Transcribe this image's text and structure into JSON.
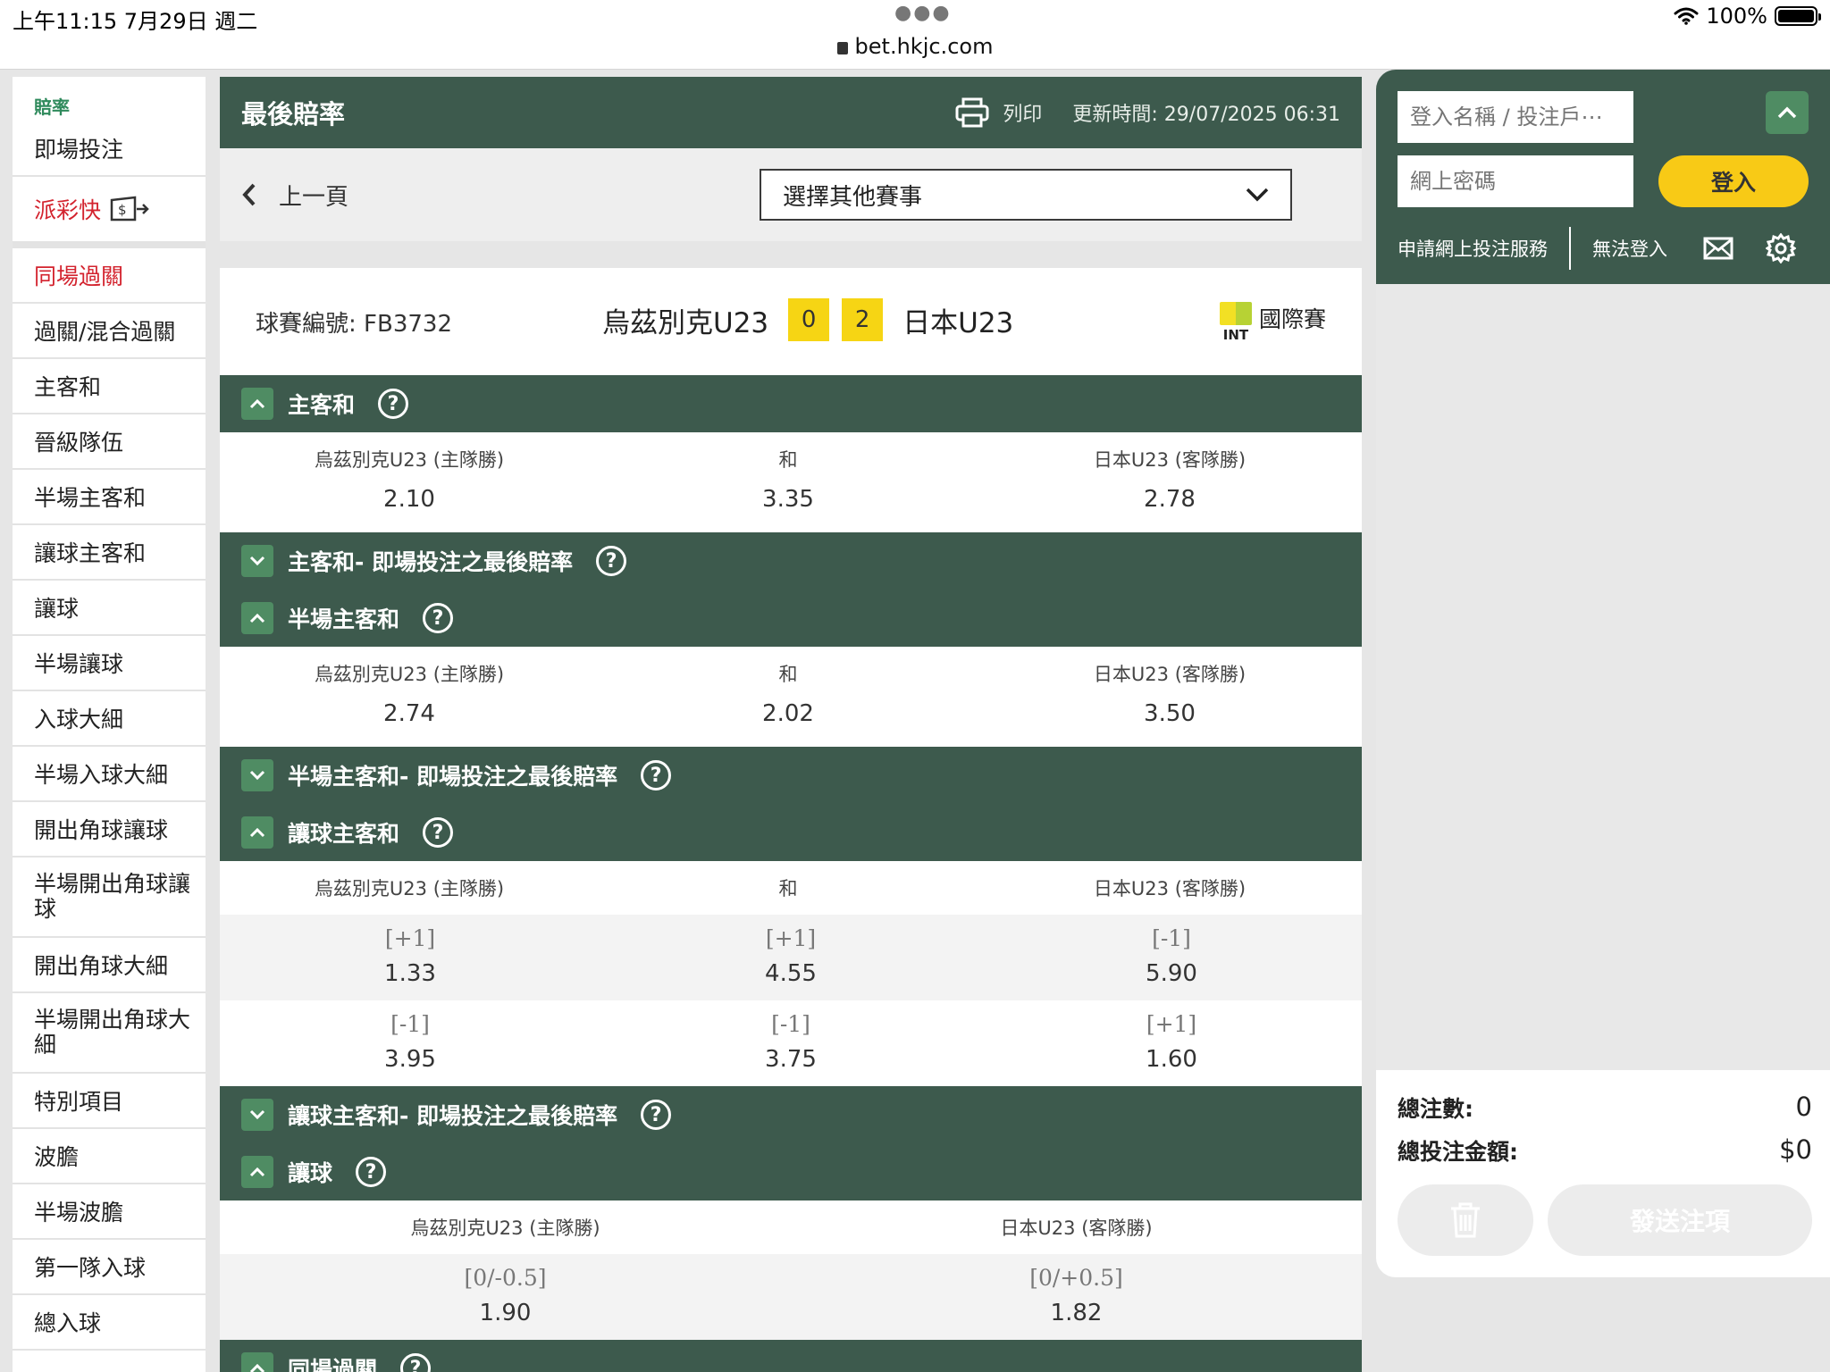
{
  "status_bar": {
    "time": "上午11:15   7月29日 週二",
    "url": "bet.hkjc.com",
    "battery": "100%",
    "battery_level": 1.0
  },
  "sidebar": {
    "header": "賠率",
    "items": [
      {
        "label": "即場投注",
        "style": "normal"
      },
      {
        "label": "派彩快",
        "style": "red-wallet"
      },
      {
        "label": "同場過關",
        "style": "red"
      },
      {
        "label": "過關/混合過關",
        "style": "normal"
      },
      {
        "label": "主客和",
        "style": "normal"
      },
      {
        "label": "晉級隊伍",
        "style": "normal"
      },
      {
        "label": "半場主客和",
        "style": "normal"
      },
      {
        "label": "讓球主客和",
        "style": "normal"
      },
      {
        "label": "讓球",
        "style": "normal"
      },
      {
        "label": "半場讓球",
        "style": "normal"
      },
      {
        "label": "入球大細",
        "style": "normal"
      },
      {
        "label": "半場入球大細",
        "style": "normal"
      },
      {
        "label": "開出角球讓球",
        "style": "normal"
      },
      {
        "label": "半場開出角球讓球",
        "style": "tall"
      },
      {
        "label": "開出角球大細",
        "style": "normal"
      },
      {
        "label": "半場開出角球大細",
        "style": "tall"
      },
      {
        "label": "特別項目",
        "style": "normal"
      },
      {
        "label": "波膽",
        "style": "normal"
      },
      {
        "label": "半場波膽",
        "style": "normal"
      },
      {
        "label": "第一隊入球",
        "style": "normal"
      },
      {
        "label": "總入球",
        "style": "normal"
      }
    ]
  },
  "header": {
    "title": "最後賠率",
    "print_label": "列印",
    "update_time": "更新時間: 29/07/2025 06:31"
  },
  "nav": {
    "back_label": "上一頁",
    "select_value": "選擇其他賽事"
  },
  "match": {
    "id_label": "球賽編號: FB3732",
    "home": "烏茲別克U23",
    "home_score": "0",
    "away_score": "2",
    "away": "日本U23",
    "tournament": "國際賽",
    "tournament_code": "INT"
  },
  "sections": {
    "hda": {
      "title": "主客和",
      "labels": [
        "烏茲別克U23 (主隊勝)",
        "和",
        "日本U23 (客隊勝)"
      ],
      "values": [
        "2.10",
        "3.35",
        "2.78"
      ]
    },
    "hda_live": {
      "title": "主客和- 即場投注之最後賠率"
    },
    "fhad": {
      "title": "半場主客和",
      "labels": [
        "烏茲別克U23 (主隊勝)",
        "和",
        "日本U23 (客隊勝)"
      ],
      "values": [
        "2.74",
        "2.02",
        "3.50"
      ]
    },
    "fhad_live": {
      "title": "半場主客和- 即場投注之最後賠率"
    },
    "hha": {
      "title": "讓球主客和",
      "labels": [
        "烏茲別克U23 (主隊勝)",
        "和",
        "日本U23 (客隊勝)"
      ],
      "rows": [
        {
          "lines": [
            "[+1]",
            "[+1]",
            "[-1]"
          ],
          "values": [
            "1.33",
            "4.55",
            "5.90"
          ]
        },
        {
          "lines": [
            "[-1]",
            "[-1]",
            "[+1]"
          ],
          "values": [
            "3.95",
            "3.75",
            "1.60"
          ]
        }
      ]
    },
    "hha_live": {
      "title": "讓球主客和- 即場投注之最後賠率"
    },
    "hdc": {
      "title": "讓球",
      "labels": [
        "烏茲別克U23 (主隊勝)",
        "日本U23 (客隊勝)"
      ],
      "lines": [
        "[0/-0.5]",
        "[0/+0.5]"
      ],
      "values": [
        "1.90",
        "1.82"
      ]
    },
    "sgp": {
      "title": "同場過關"
    }
  },
  "login": {
    "username_placeholder": "登入名稱 / 投注戶⋯",
    "password_placeholder": "網上密碼",
    "login_label": "登入",
    "apply_label": "申請網上投注服務",
    "cannot_login_label": "無法登入"
  },
  "betslip": {
    "count_label": "總注數:",
    "count_value": "0",
    "amount_label": "總投注金額:",
    "amount_value": "$0",
    "send_label": "發送注項"
  },
  "colors": {
    "header_green": "#3d5a4d",
    "toggle_green": "#4f8c63",
    "score_yellow": "#f6d514",
    "login_yellow": "#f8ca16",
    "accent_red": "#d3232e"
  }
}
